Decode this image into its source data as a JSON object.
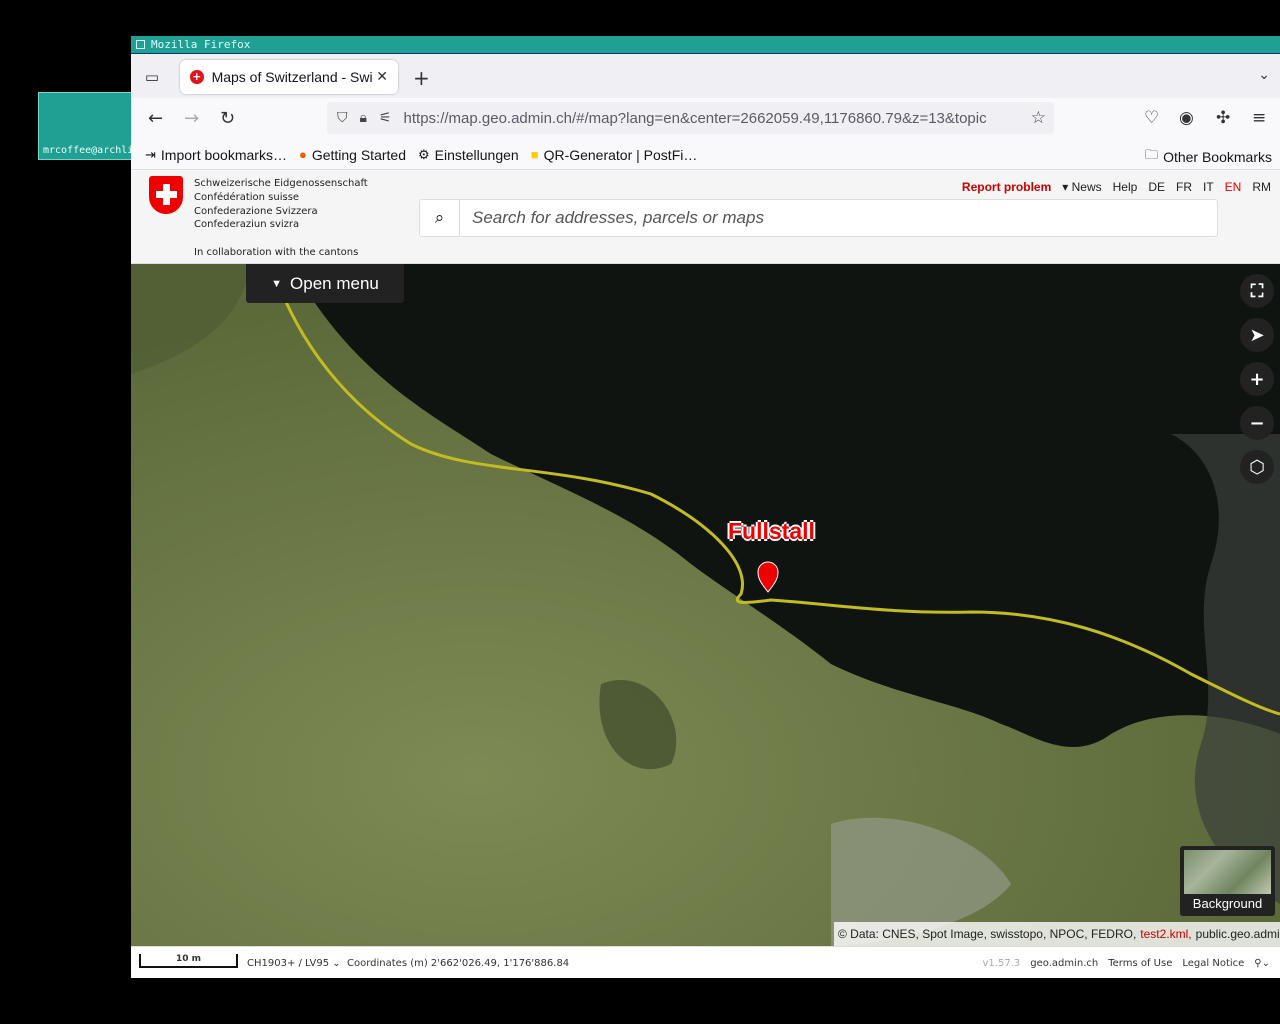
{
  "desktop": {
    "terminal_label": "mrcoffee@archli"
  },
  "window": {
    "wm_title": "Mozilla Firefox"
  },
  "browser": {
    "tab_title": "Maps of Switzerland - Swi",
    "url": "https://map.geo.admin.ch/#/map?lang=en&center=2662059.49,1176860.79&z=13&topic",
    "bookmarks": [
      "Import bookmarks…",
      "Getting Started",
      "Einstellungen",
      "QR-Generator | PostFi…"
    ],
    "other_bookmarks": "Other Bookmarks"
  },
  "header": {
    "confederation": [
      "Schweizerische Eidgenossenschaft",
      "Confédération suisse",
      "Confederazione Svizzera",
      "Confederaziun svizra"
    ],
    "collaboration": "In collaboration with the cantons",
    "report_problem": "Report problem",
    "news": "▾ News",
    "help": "Help",
    "languages": [
      "DE",
      "FR",
      "IT",
      "EN",
      "RM"
    ],
    "active_language": "EN",
    "search_placeholder": "Search for addresses, parcels or maps"
  },
  "map": {
    "menu_button": "Open menu",
    "marker_label": "Fullstall",
    "background_label": "Background",
    "attribution_prefix": "© Data:",
    "attribution_sources": "CNES, Spot Image, swisstopo, NPOC, FEDRO,",
    "attribution_kml": "test2.kml,",
    "attribution_public": "public.geo.admin.ch"
  },
  "footer": {
    "scale": "10 m",
    "projection": "CH1903+ / LV95",
    "coordinates": "Coordinates (m) 2'662'026.49, 1'176'886.84",
    "version": "v1.57.3",
    "geo_admin": "geo.admin.ch",
    "terms": "Terms of Use",
    "legal": "Legal Notice"
  }
}
